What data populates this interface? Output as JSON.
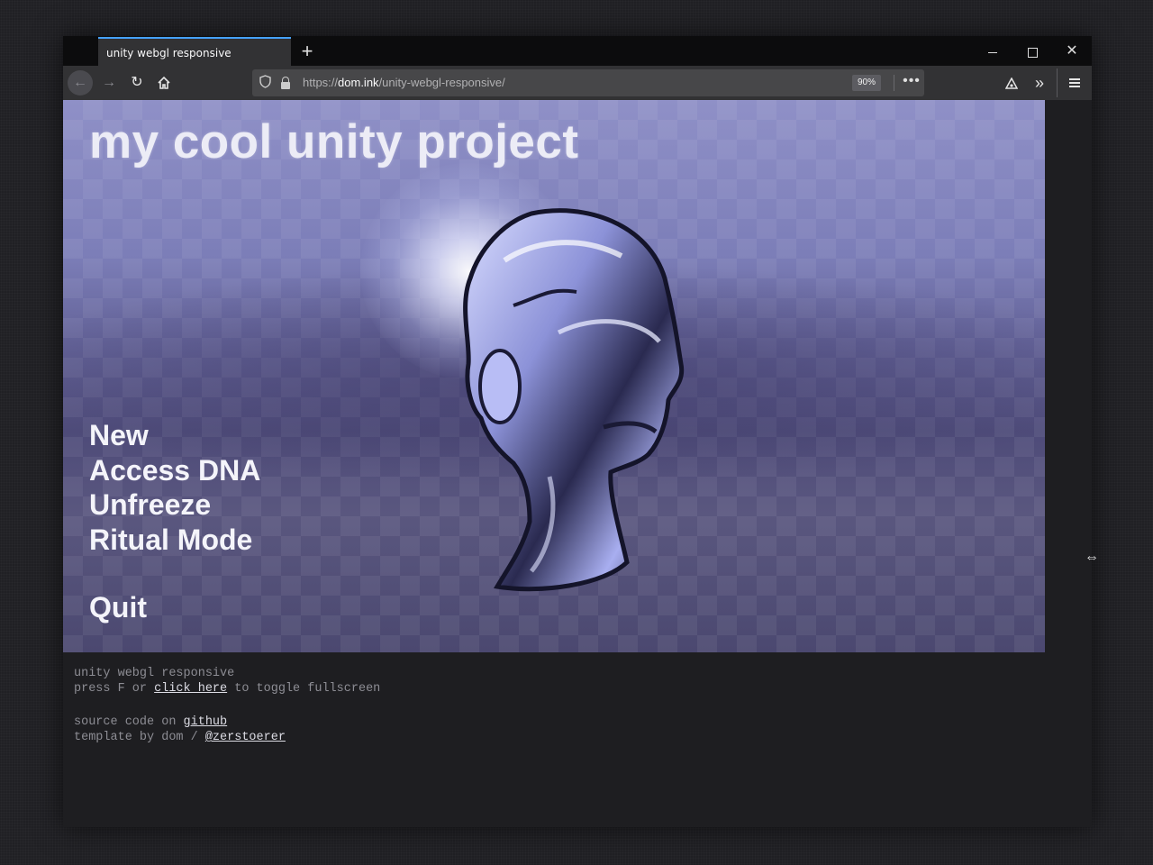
{
  "browser": {
    "tab_title": "unity webgl responsive",
    "new_tab_symbol": "+",
    "url_scheme": "https://",
    "url_host": "dom.ink",
    "url_path": "/unity-webgl-responsive/",
    "zoom": "90%",
    "page_actions": "•••"
  },
  "game": {
    "title": "my cool unity project",
    "menu": [
      "New",
      "Access DNA",
      "Unfreeze",
      "Ritual Mode"
    ],
    "quit": "Quit"
  },
  "info": {
    "line1": "unity webgl responsive",
    "line2_prefix": "press F or ",
    "line2_link": "click here",
    "line2_suffix": " to toggle fullscreen",
    "line3_prefix": "source code on ",
    "line3_link": "github",
    "line4_prefix": "template by dom / ",
    "line4_link": "@zerstoerer"
  },
  "icons": [
    "back-arrow-icon",
    "forward-arrow-icon",
    "reload-icon",
    "home-icon",
    "shield-icon",
    "lock-icon",
    "extension-icon",
    "overflow-chevron-icon",
    "hamburger-menu-icon",
    "resize-cursor-icon"
  ]
}
